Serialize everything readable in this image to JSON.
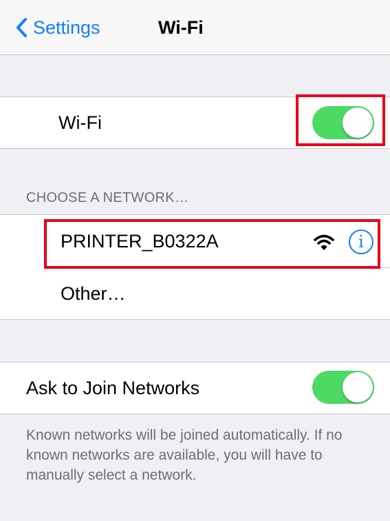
{
  "navbar": {
    "back_label": "Settings",
    "title": "Wi-Fi"
  },
  "wifi_toggle": {
    "label": "Wi-Fi",
    "state": "on"
  },
  "networks": {
    "header": "CHOOSE A NETWORK…",
    "items": [
      {
        "name": "PRINTER_B0322A"
      },
      {
        "name": "Other…"
      }
    ]
  },
  "ask_to_join": {
    "label": "Ask to Join Networks",
    "state": "on",
    "description": "Known networks will be joined automatically. If no known networks are available, you will have to manually select a network."
  },
  "icons": {
    "back": "chevron-left-icon",
    "signal": "wifi-signal-icon",
    "info": "info-icon"
  },
  "colors": {
    "accent": "#147efb",
    "toggle_on": "#4cd964",
    "highlight": "#e5001c",
    "background": "#efeff4"
  },
  "annotation": {
    "info_glyph": "i"
  }
}
